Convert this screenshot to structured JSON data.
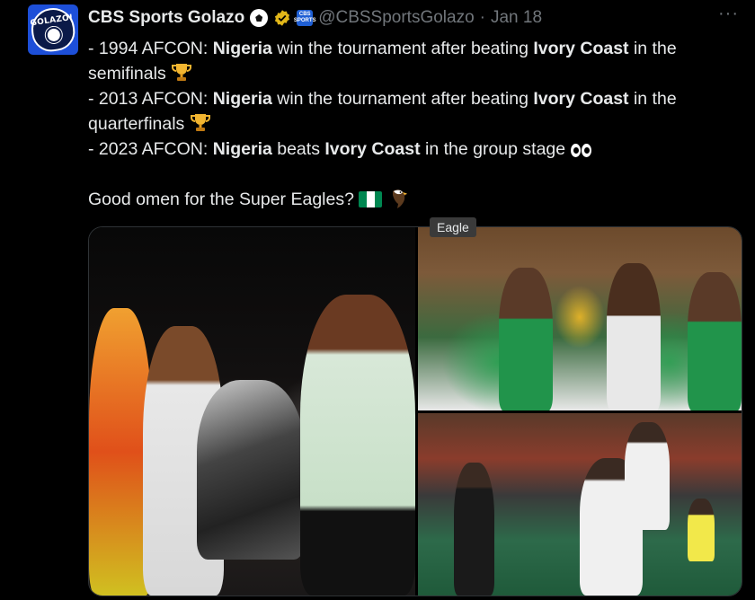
{
  "tweet": {
    "author": {
      "display_name": "CBS Sports Golazo",
      "handle": "@CBSSportsGolazo",
      "avatar_text": "GOLAZO!",
      "affiliate_badge_text": "CBS SPORTS",
      "icons": [
        "soccer-ball-icon",
        "verified-badge-icon",
        "cbs-sports-affiliate-icon"
      ]
    },
    "separator": "·",
    "date": "Jan 18",
    "lines": [
      [
        {
          "t": "- 1994 AFCON: "
        },
        {
          "t": "Nigeria",
          "b": true
        },
        {
          "t": " win the tournament after beating "
        },
        {
          "t": "Ivory Coast",
          "b": true
        },
        {
          "t": " in the semifinals "
        },
        {
          "icon": "trophy"
        }
      ],
      [
        {
          "t": "- 2013 AFCON: "
        },
        {
          "t": "Nigeria",
          "b": true
        },
        {
          "t": " win the tournament after beating "
        },
        {
          "t": "Ivory Coast",
          "b": true
        },
        {
          "t": " in the quarterfinals "
        },
        {
          "icon": "trophy"
        }
      ],
      [
        {
          "t": "- 2023 AFCON: "
        },
        {
          "t": "Nigeria",
          "b": true
        },
        {
          "t": " beats "
        },
        {
          "t": "Ivory Coast",
          "b": true
        },
        {
          "t": " in the group stage "
        },
        {
          "icon": "eyes"
        }
      ],
      [],
      [
        {
          "t": "Good omen for the Super Eagles? "
        },
        {
          "icon": "nigeria-flag"
        },
        {
          "icon": "eagle"
        }
      ]
    ],
    "tooltip": "Eagle",
    "media": [
      {
        "name": "photo-1994-trophy-celebration"
      },
      {
        "name": "photo-2013-trophy-celebration"
      },
      {
        "name": "photo-2023-match-celebration"
      }
    ]
  },
  "colors": {
    "background": "#000000",
    "text": "#e7e9ea",
    "muted": "#71767b",
    "verified": "#e2b719",
    "nigeria_green": "#008751"
  }
}
